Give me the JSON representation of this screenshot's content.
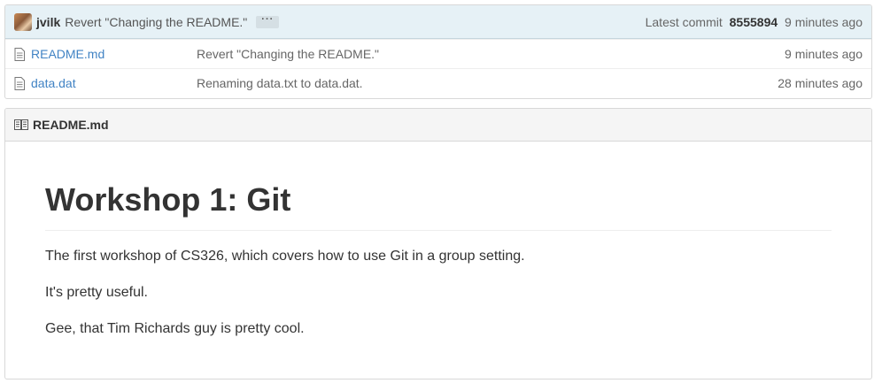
{
  "commit": {
    "author": "jvilk",
    "message": "Revert \"Changing the README.\"",
    "ellipsis": "···",
    "latest_label": "Latest commit",
    "sha": "8555894",
    "age": "9 minutes ago"
  },
  "files": [
    {
      "name": "README.md",
      "message": "Revert \"Changing the README.\"",
      "age": "9 minutes ago",
      "icon": "file-text-icon"
    },
    {
      "name": "data.dat",
      "message": "Renaming data.txt to data.dat.",
      "age": "28 minutes ago",
      "icon": "file-text-icon"
    }
  ],
  "readme": {
    "header": "README.md",
    "icon": "book-icon",
    "title": "Workshop 1: Git",
    "paragraphs": [
      "The first workshop of CS326, which covers how to use Git in a group setting.",
      "It's pretty useful.",
      "Gee, that Tim Richards guy is pretty cool."
    ]
  },
  "colors": {
    "link": "#4183c4",
    "commit_bar_bg": "#e6f1f6",
    "readme_header_bg": "#f5f5f5"
  }
}
